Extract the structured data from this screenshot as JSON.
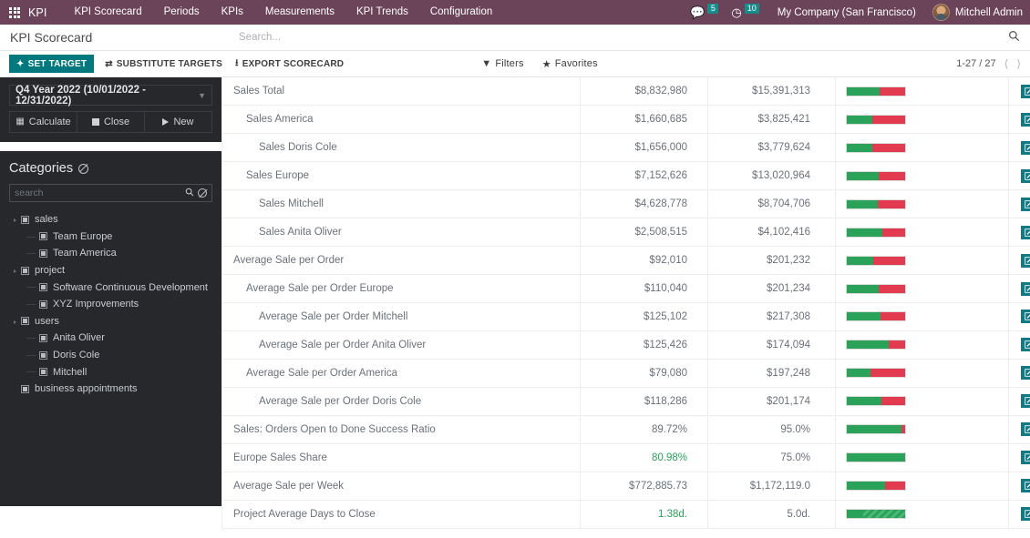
{
  "topbar": {
    "apps_icon": "grid-apps-icon",
    "app_name": "KPI",
    "menu": [
      {
        "label": "KPI Scorecard"
      },
      {
        "label": "Periods"
      },
      {
        "label": "KPIs"
      },
      {
        "label": "Measurements"
      },
      {
        "label": "KPI Trends"
      },
      {
        "label": "Configuration"
      }
    ],
    "messages_icon": "chat-bubble-icon",
    "messages_count": "5",
    "activities_icon": "clock-icon",
    "activities_count": "10",
    "company": "My Company (San Francisco)",
    "avatar_icon": "user-avatar",
    "user": "Mitchell Admin",
    "accent": "#6b4459",
    "badge_color": "#178c8c"
  },
  "control_panel": {
    "title": "KPI Scorecard",
    "search_placeholder": "Search...",
    "search_value": "",
    "search_icon": "search-icon"
  },
  "action_bar": {
    "set_target": "SET TARGET",
    "set_target_icon": "diamond-plus-icon",
    "substitute_targets": "SUBSTITUTE TARGETS",
    "substitute_icon": "exchange-arrows-icon",
    "export_scorecard": "EXPORT SCORECARD",
    "export_icon": "download-icon",
    "filters": "Filters",
    "filters_icon": "funnel-icon",
    "favorites": "Favorites",
    "favorites_icon": "star-icon",
    "pager": "1-27 / 27",
    "prev_icon": "chevron-left-icon",
    "next_icon": "chevron-right-icon",
    "primary_color": "#00787d"
  },
  "sidebar": {
    "period": {
      "label": "Q4 Year 2022 (10/01/2022 - 12/31/2022)",
      "caret_icon": "chevron-down-icon",
      "buttons": [
        {
          "label": "Calculate",
          "icon": "calculator-icon"
        },
        {
          "label": "Close",
          "icon": "stop-square-icon"
        },
        {
          "label": "New",
          "icon": "play-triangle-icon"
        }
      ]
    },
    "categories": {
      "title": "Categories",
      "clear_icon": "no-entry-icon",
      "search_placeholder": "search",
      "search_value": "",
      "search_icon": "search-icon",
      "clear_search_icon": "no-entry-icon",
      "tree": [
        {
          "label": "sales",
          "level": 0,
          "has_children": true
        },
        {
          "label": "Team Europe",
          "level": 1,
          "has_children": false
        },
        {
          "label": "Team America",
          "level": 1,
          "has_children": false
        },
        {
          "label": "project",
          "level": 0,
          "has_children": true
        },
        {
          "label": "Software Continuous Development",
          "level": 1,
          "has_children": false
        },
        {
          "label": "XYZ Improvements",
          "level": 1,
          "has_children": false
        },
        {
          "label": "users",
          "level": 0,
          "has_children": true
        },
        {
          "label": "Anita Oliver",
          "level": 1,
          "has_children": false
        },
        {
          "label": "Doris Cole",
          "level": 1,
          "has_children": false
        },
        {
          "label": "Mitchell",
          "level": 1,
          "has_children": false
        },
        {
          "label": "business appointments",
          "level": 0,
          "has_children": false
        }
      ]
    }
  },
  "table": {
    "edit_icon": "pencil-square-icon",
    "chart_icon": "bar-chart-icon",
    "delete_icon": "close-x-icon",
    "rows": [
      {
        "name": "Sales Total",
        "indent": 0,
        "value": "$8,832,980",
        "target": "$15,391,313",
        "value_state": "bad",
        "green_pct": 57,
        "striped": false
      },
      {
        "name": "Sales America",
        "indent": 1,
        "value": "$1,660,685",
        "target": "$3,825,421",
        "value_state": "bad",
        "green_pct": 43,
        "striped": false
      },
      {
        "name": "Sales Doris Cole",
        "indent": 2,
        "value": "$1,656,000",
        "target": "$3,779,624",
        "value_state": "bad",
        "green_pct": 44,
        "striped": false
      },
      {
        "name": "Sales Europe",
        "indent": 1,
        "value": "$7,152,626",
        "target": "$13,020,964",
        "value_state": "bad",
        "green_pct": 55,
        "striped": false
      },
      {
        "name": "Sales Mitchell",
        "indent": 2,
        "value": "$4,628,778",
        "target": "$8,704,706",
        "value_state": "bad",
        "green_pct": 53,
        "striped": false
      },
      {
        "name": "Sales Anita Oliver",
        "indent": 2,
        "value": "$2,508,515",
        "target": "$4,102,416",
        "value_state": "bad",
        "green_pct": 61,
        "striped": false
      },
      {
        "name": "Average Sale per Order",
        "indent": 0,
        "value": "$92,010",
        "target": "$201,232",
        "value_state": "bad",
        "green_pct": 46,
        "striped": false
      },
      {
        "name": "Average Sale per Order Europe",
        "indent": 1,
        "value": "$110,040",
        "target": "$201,234",
        "value_state": "bad",
        "green_pct": 55,
        "striped": false
      },
      {
        "name": "Average Sale per Order Mitchell",
        "indent": 2,
        "value": "$125,102",
        "target": "$217,308",
        "value_state": "bad",
        "green_pct": 58,
        "striped": false
      },
      {
        "name": "Average Sale per Order Anita Oliver",
        "indent": 2,
        "value": "$125,426",
        "target": "$174,094",
        "value_state": "bad",
        "green_pct": 72,
        "striped": false
      },
      {
        "name": "Average Sale per Order America",
        "indent": 1,
        "value": "$79,080",
        "target": "$197,248",
        "value_state": "bad",
        "green_pct": 40,
        "striped": false
      },
      {
        "name": "Average Sale per Order Doris Cole",
        "indent": 2,
        "value": "$118,286",
        "target": "$201,174",
        "value_state": "bad",
        "green_pct": 59,
        "striped": false
      },
      {
        "name": "Sales: Orders Open to Done Success Ratio",
        "indent": 0,
        "value": "89.72%",
        "target": "95.0%",
        "value_state": "bad",
        "green_pct": 94,
        "striped": false
      },
      {
        "name": "Europe Sales Share",
        "indent": 0,
        "value": "80.98%",
        "target": "75.0%",
        "value_state": "good",
        "green_pct": 100,
        "striped": false
      },
      {
        "name": "Average Sale per Week",
        "indent": 0,
        "value": "$772,885.73",
        "target": "$1,172,119.0",
        "value_state": "bad",
        "green_pct": 66,
        "striped": false
      },
      {
        "name": "Project Average Days to Close",
        "indent": 0,
        "value": "1.38d.",
        "target": "5.0d.",
        "value_state": "good",
        "green_pct": 28,
        "striped": true
      }
    ]
  }
}
